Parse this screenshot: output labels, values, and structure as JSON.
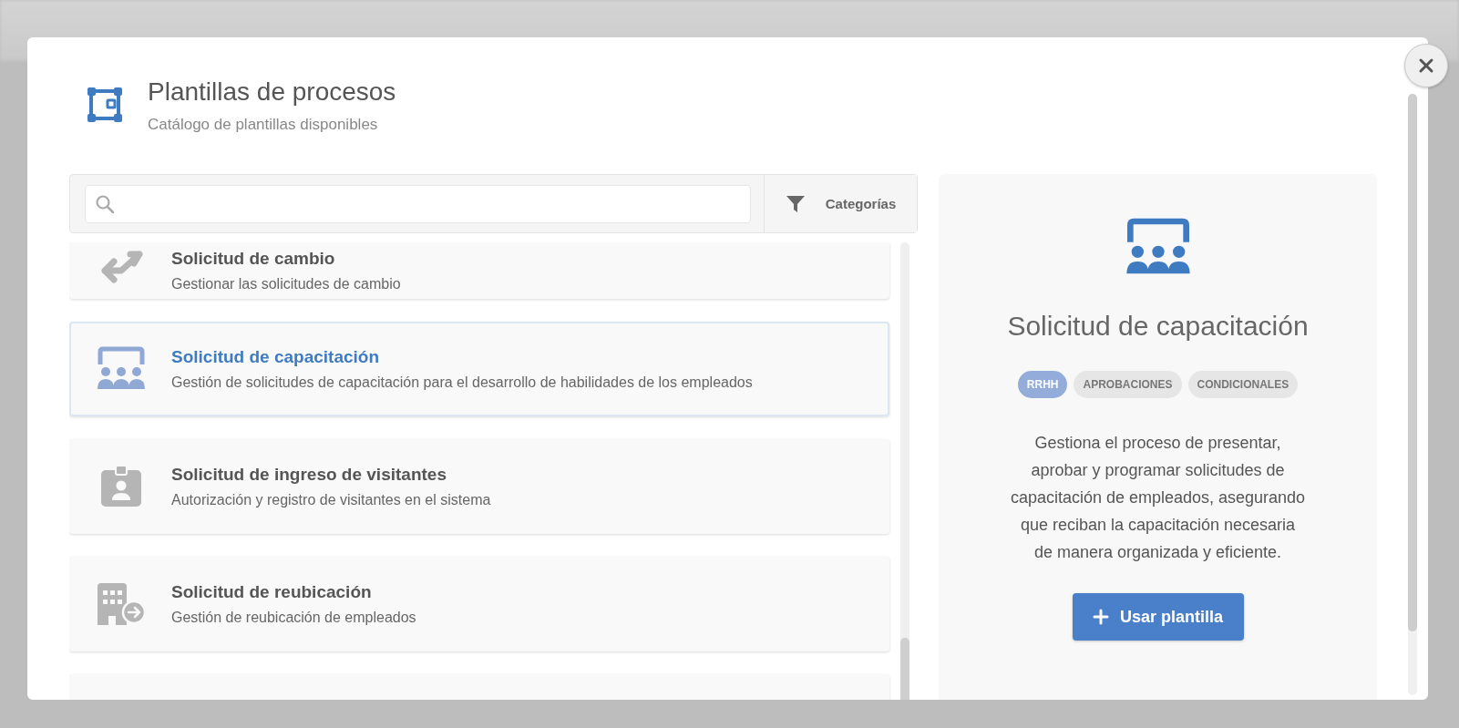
{
  "header": {
    "title": "Plantillas de procesos",
    "subtitle": "Catálogo de plantillas disponibles"
  },
  "filter_button": {
    "label": "Categorías"
  },
  "templates": [
    {
      "title": "Solicitud de cambio",
      "description": "Gestionar las solicitudes de cambio",
      "selected": false
    },
    {
      "title": "Solicitud de capacitación",
      "description": "Gestión de solicitudes de capacitación para el desarrollo de habilidades de los empleados",
      "selected": true
    },
    {
      "title": "Solicitud de ingreso de visitantes",
      "description": "Autorización y registro de visitantes en el sistema",
      "selected": false
    },
    {
      "title": "Solicitud de reubicación",
      "description": "Gestión de reubicación de empleados",
      "selected": false
    }
  ],
  "detail": {
    "title": "Solicitud de capacitación",
    "tags": [
      {
        "label": "RRHH",
        "color": "#93acd9"
      },
      {
        "label": "APROBACIONES",
        "color": "#e6e6e6"
      },
      {
        "label": "CONDICIONALES",
        "color": "#e6e6e6"
      }
    ],
    "description": "Gestiona el proceso de presentar, aprobar y programar solicitudes de capacitación de empleados, asegurando que reciban la capacitación necesaria de manera organizada y eficiente.",
    "button": {
      "label": "Usar plantilla"
    }
  }
}
